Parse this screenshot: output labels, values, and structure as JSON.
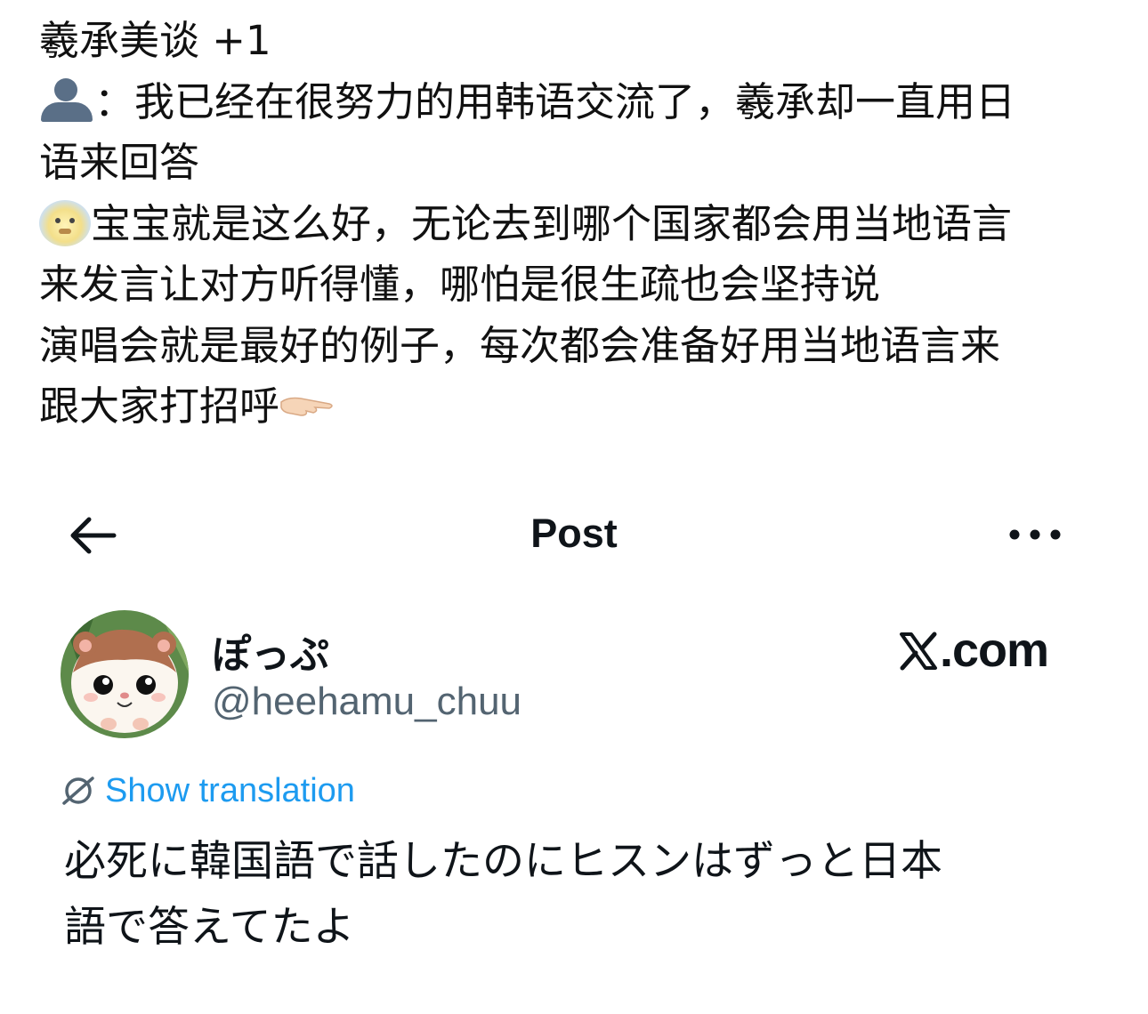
{
  "caption": {
    "line1": "羲承美谈 +1",
    "line2": "：我已经在很努力的用韩语交流了，羲承却一直用日",
    "line3": "语来回答",
    "line4": "宝宝就是这么好，无论去到哪个国家都会用当地语言",
    "line5": "来发言让对方听得懂，哪怕是很生疏也会坚持说",
    "line6": "演唱会就是最好的例子，每次都会准备好用当地语言来",
    "line7": "跟大家打招呼",
    "icons": [
      "person-silhouette-icon",
      "dizzy-face-icon",
      "pointing-hand-icon"
    ]
  },
  "header": {
    "title": "Post",
    "back_icon": "arrow-left-icon",
    "more_icon": "more-dots-icon"
  },
  "post": {
    "display_name": "ぽっぷ",
    "handle": "@heehamu_chuu",
    "source": ".com",
    "source_icon": "x-logo-icon",
    "translate_label": "Show translation",
    "text_line1": "必死に韓国語で話したのにヒスンはずっと日本",
    "text_line2": "語で答えてたよ"
  },
  "colors": {
    "link": "#1d9bf0",
    "handle": "#536471",
    "text": "#0f1419"
  }
}
